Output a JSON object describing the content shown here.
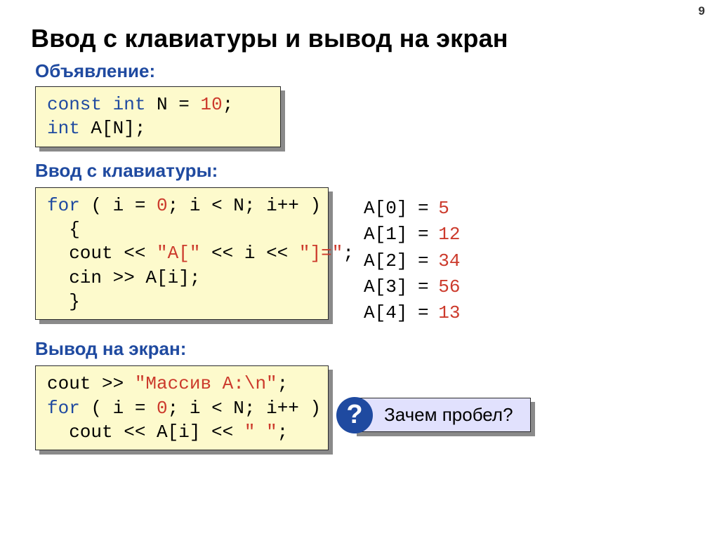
{
  "page_number": "9",
  "title": "Ввод с клавиатуры и вывод на экран",
  "section1_label": "Объявление:",
  "box1": {
    "l1_kw1": "const",
    "l1_kw2": "int",
    "l1_txt1": " N",
    "l1_eq": " = ",
    "l1_num": "10",
    "l1_sc": ";",
    "l2_kw": "int",
    "l2_txt": " A[N];"
  },
  "section2_label": "Ввод с клавиатуры:",
  "box2": {
    "l1_kw": "for",
    "l1_txt1": " ( i",
    "l1_eq": " = ",
    "l1_num": "0",
    "l1_txt2": "; i",
    "l1_lt": " < ",
    "l1_txt3": "N; i++ )",
    "l2": "  {",
    "l3_a": "  cout << ",
    "l3_s1": "\"A[\"",
    "l3_b": " << i << ",
    "l3_s2": "\"]=\"",
    "l3_c": ";",
    "l4": "  cin >> A[i];",
    "l5": "  }"
  },
  "sample_output": [
    {
      "lhs": "A[0]",
      "val": "5"
    },
    {
      "lhs": "A[1]",
      "val": "12"
    },
    {
      "lhs": "A[2]",
      "val": "34"
    },
    {
      "lhs": "A[3]",
      "val": "56"
    },
    {
      "lhs": "A[4]",
      "val": "13"
    }
  ],
  "section3_label": "Вывод на экран:",
  "box3": {
    "l1_a": "cout >> ",
    "l1_s": "\"Массив A:\\n\"",
    "l1_b": ";",
    "l2_kw": "for",
    "l2_txt1": " ( i",
    "l2_eq": " = ",
    "l2_num": "0",
    "l2_txt2": "; i",
    "l2_lt": " < ",
    "l2_txt3": "N; i++ )",
    "l3_a": "  cout << A[i] << ",
    "l3_s": "\" \"",
    "l3_b": ";"
  },
  "question_mark": "?",
  "question_text": "Зачем пробел?"
}
